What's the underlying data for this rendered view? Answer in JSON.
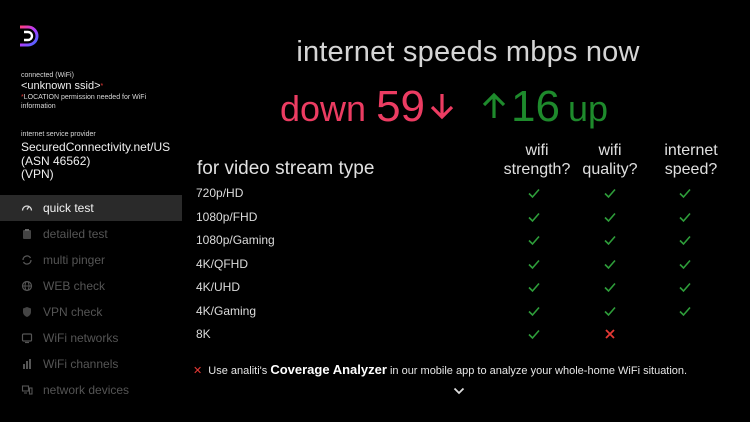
{
  "sidebar": {
    "connection_status": "connected (WiFi)",
    "ssid": "<unknown ssid>",
    "location_note": "LOCATION permission needed for WiFi information",
    "isp_label": "internet service provider",
    "isp_lines": [
      "SecuredConnectivity.net/US",
      "(ASN 46562)",
      "(VPN)"
    ],
    "menu": [
      {
        "label": "quick test",
        "icon": "gauge-icon",
        "active": true
      },
      {
        "label": "detailed test",
        "icon": "clipboard-icon",
        "active": false
      },
      {
        "label": "multi pinger",
        "icon": "sync-icon",
        "active": false
      },
      {
        "label": "WEB check",
        "icon": "globe-icon",
        "active": false
      },
      {
        "label": "VPN check",
        "icon": "shield-icon",
        "active": false
      },
      {
        "label": "WiFi networks",
        "icon": "wifi-icon",
        "active": false
      },
      {
        "label": "WiFi channels",
        "icon": "bar-chart-icon",
        "active": false
      },
      {
        "label": "network devices",
        "icon": "device-icon",
        "active": false
      }
    ]
  },
  "main": {
    "title": "internet speeds mbps now",
    "down_label": "down",
    "down_value": "59",
    "up_value": "16",
    "up_label": "up",
    "stream_header": "for video stream type",
    "columns": [
      {
        "line1": "wifi",
        "line2": "strength?"
      },
      {
        "line1": "wifi",
        "line2": "quality?"
      },
      {
        "line1": "internet",
        "line2": "speed?"
      }
    ],
    "rows": [
      {
        "label": "720p/HD",
        "strength": "pass",
        "quality": "pass",
        "speed": "pass"
      },
      {
        "label": "1080p/FHD",
        "strength": "pass",
        "quality": "pass",
        "speed": "pass"
      },
      {
        "label": "1080p/Gaming",
        "strength": "pass",
        "quality": "pass",
        "speed": "pass"
      },
      {
        "label": "4K/QFHD",
        "strength": "pass",
        "quality": "pass",
        "speed": "pass"
      },
      {
        "label": "4K/UHD",
        "strength": "pass",
        "quality": "pass",
        "speed": "pass"
      },
      {
        "label": "4K/Gaming",
        "strength": "pass",
        "quality": "pass",
        "speed": "pass"
      },
      {
        "label": "8K",
        "strength": "pass",
        "quality": "fail",
        "speed": "none"
      }
    ],
    "footer_prefix": "Use analiti's",
    "footer_bold": "Coverage Analyzer",
    "footer_suffix": "in our mobile app to analyze your whole-home WiFi situation."
  },
  "colors": {
    "down": "#ec3c62",
    "up": "#1e8a2c",
    "pass": "#2e9e3a",
    "fail": "#e53935"
  }
}
